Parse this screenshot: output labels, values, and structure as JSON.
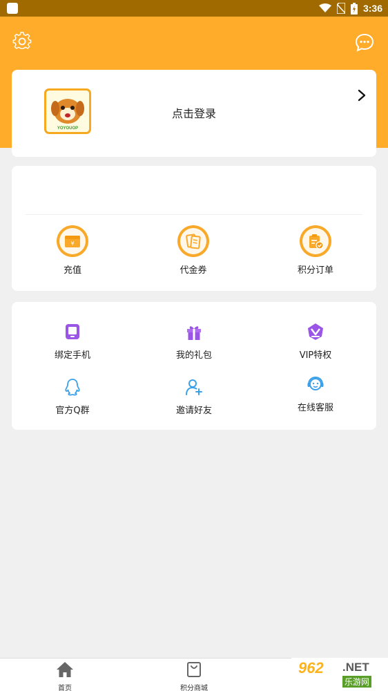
{
  "status_bar": {
    "time": "3:36"
  },
  "login": {
    "text": "点击登录",
    "avatar_caption": "YOYOUOP"
  },
  "wallet": {
    "items": [
      {
        "label": "充值",
        "icon": "recharge-icon"
      },
      {
        "label": "代金券",
        "icon": "voucher-icon"
      },
      {
        "label": "积分订单",
        "icon": "points-order-icon"
      }
    ]
  },
  "services": {
    "items": [
      {
        "label": "绑定手机",
        "icon": "bind-phone-icon"
      },
      {
        "label": "我的礼包",
        "icon": "gift-icon"
      },
      {
        "label": "VIP特权",
        "icon": "vip-icon"
      },
      {
        "label": "官方Q群",
        "icon": "qq-group-icon"
      },
      {
        "label": "邀请好友",
        "icon": "invite-friend-icon"
      },
      {
        "label": "在线客服",
        "icon": "customer-service-icon"
      }
    ]
  },
  "tabbar": {
    "items": [
      {
        "label": "首页",
        "icon": "home-icon"
      },
      {
        "label": "积分商城",
        "icon": "shopping-bag-icon"
      }
    ]
  },
  "watermark": {
    "number": "962",
    "net": ".NET",
    "cn": "乐游网"
  },
  "colors": {
    "brand": "#ffac2b",
    "accent": "#f8a929",
    "purple": "#9b55e6",
    "blue": "#3aa0e8"
  }
}
